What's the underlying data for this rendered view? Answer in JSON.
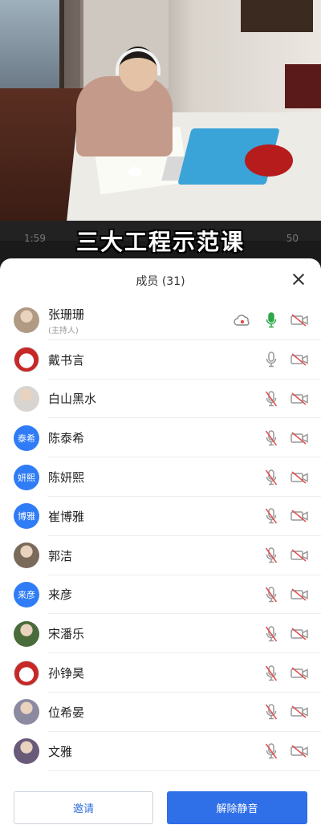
{
  "video": {
    "caption": "三大工程示范课"
  },
  "status_bar": {
    "time": "1:59",
    "signal": "50"
  },
  "panel": {
    "title": "成员 (31)"
  },
  "members": [
    {
      "name": "张珊珊",
      "role": "(主持人)",
      "avatar_text": "",
      "avatar_style": "photo",
      "mic": "on",
      "cloud": true
    },
    {
      "name": "戴书言",
      "role": "",
      "avatar_text": "",
      "avatar_style": "cartoon",
      "mic": "idle",
      "cloud": false
    },
    {
      "name": "白山黑水",
      "role": "",
      "avatar_text": "",
      "avatar_style": "photo",
      "mic": "muted",
      "cloud": false
    },
    {
      "name": "陈泰希",
      "role": "",
      "avatar_text": "泰希",
      "avatar_style": "blue",
      "mic": "muted",
      "cloud": false
    },
    {
      "name": "陈妍熙",
      "role": "",
      "avatar_text": "妍熙",
      "avatar_style": "blue",
      "mic": "muted",
      "cloud": false
    },
    {
      "name": "崔博雅",
      "role": "",
      "avatar_text": "博雅",
      "avatar_style": "blue",
      "mic": "muted",
      "cloud": false
    },
    {
      "name": "郭洁",
      "role": "",
      "avatar_text": "",
      "avatar_style": "photo",
      "mic": "muted",
      "cloud": false
    },
    {
      "name": "来彦",
      "role": "",
      "avatar_text": "来彦",
      "avatar_style": "blue",
      "mic": "muted",
      "cloud": false
    },
    {
      "name": "宋潘乐",
      "role": "",
      "avatar_text": "",
      "avatar_style": "photo",
      "mic": "muted",
      "cloud": false
    },
    {
      "name": "孙铮昊",
      "role": "",
      "avatar_text": "",
      "avatar_style": "cartoon",
      "mic": "muted",
      "cloud": false
    },
    {
      "name": "位希晏",
      "role": "",
      "avatar_text": "",
      "avatar_style": "photo",
      "mic": "muted",
      "cloud": false
    },
    {
      "name": "文雅",
      "role": "",
      "avatar_text": "",
      "avatar_style": "photo",
      "mic": "muted",
      "cloud": false
    }
  ],
  "footer": {
    "invite_label": "邀请",
    "unmute_label": "解除静音"
  },
  "colors": {
    "primary": "#2f6fe8",
    "mic_active": "#2ea84a",
    "muted_red": "#e05050",
    "avatar_blue": "#2f7cf6"
  }
}
